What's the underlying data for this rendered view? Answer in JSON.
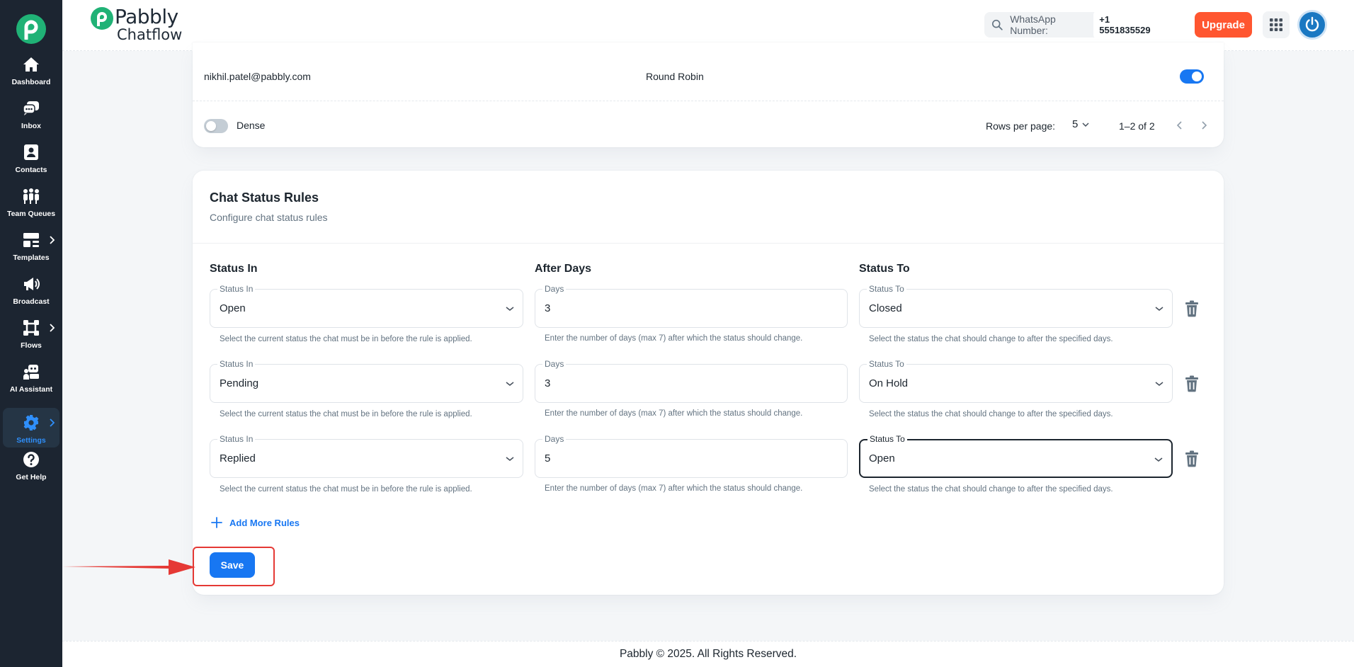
{
  "sidebar": {
    "items": [
      {
        "label": "Dashboard",
        "icon": "home-icon"
      },
      {
        "label": "Inbox",
        "icon": "chat-icon"
      },
      {
        "label": "Contacts",
        "icon": "contacts-icon"
      },
      {
        "label": "Team Queues",
        "icon": "team-icon"
      },
      {
        "label": "Templates",
        "icon": "templates-icon"
      },
      {
        "label": "Broadcast",
        "icon": "megaphone-icon"
      },
      {
        "label": "Flows",
        "icon": "flows-icon"
      },
      {
        "label": "AI Assistant",
        "icon": "robot-icon"
      },
      {
        "label": "Settings",
        "icon": "gear-icon"
      },
      {
        "label": "Get Help",
        "icon": "help-icon"
      }
    ],
    "active": "Settings"
  },
  "header": {
    "brand_name": "Pabbly",
    "brand_sub": "Chatflow",
    "whatsapp_label": "WhatsApp Number:",
    "whatsapp_number": "+1 5551835529",
    "upgrade_label": "Upgrade"
  },
  "table": {
    "row": {
      "email": "nikhil.patel@pabbly.com",
      "routing": "Round Robin",
      "enabled": true
    },
    "dense_label": "Dense",
    "rows_per_page_label": "Rows per page:",
    "rows_per_page_value": "5",
    "page_range": "1–2 of 2"
  },
  "rules": {
    "title": "Chat Status Rules",
    "subtitle": "Configure chat status rules",
    "columns": {
      "status_in": "Status In",
      "after_days": "After Days",
      "status_to": "Status To"
    },
    "field_labels": {
      "status_in": "Status In",
      "days": "Days",
      "status_to": "Status To"
    },
    "helpers": {
      "status_in": "Select the current status the chat must be in before the rule is applied.",
      "days": "Enter the number of days (max 7) after which the status should change.",
      "status_to": "Select the status the chat should change to after the specified days."
    },
    "rows": [
      {
        "status_in": "Open",
        "days": "3",
        "status_to": "Closed"
      },
      {
        "status_in": "Pending",
        "days": "3",
        "status_to": "On Hold"
      },
      {
        "status_in": "Replied",
        "days": "5",
        "status_to": "Open"
      }
    ],
    "add_more_label": "Add More Rules",
    "save_label": "Save"
  },
  "footer": {
    "text": "Pabbly © 2025. All Rights Reserved."
  },
  "colors": {
    "primary": "#1877f2",
    "upgrade": "#ff5630",
    "sidebar": "#1c2531",
    "brand": "#20b276",
    "highlight": "#e53935"
  }
}
